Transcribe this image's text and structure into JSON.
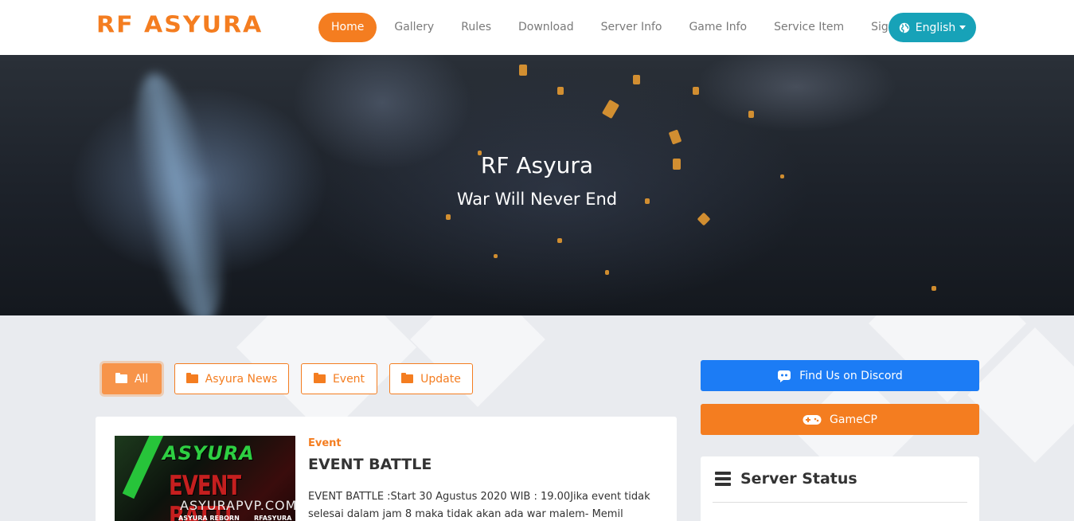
{
  "brand": {
    "logo": "RF ASYURA",
    "accent_color": "#f47d20",
    "info_color": "#17a2b8",
    "discord_color": "#1c7cf5"
  },
  "nav": {
    "items": [
      {
        "label": "Home",
        "active": true
      },
      {
        "label": "Gallery"
      },
      {
        "label": "Rules"
      },
      {
        "label": "Download"
      },
      {
        "label": "Server Info"
      },
      {
        "label": "Game Info"
      },
      {
        "label": "Service Item"
      },
      {
        "label": "Signup"
      }
    ],
    "language": {
      "label": "English",
      "icon": "globe-icon"
    }
  },
  "hero": {
    "title": "RF Asyura",
    "subtitle": "War Will Never End"
  },
  "filters": [
    {
      "label": "All",
      "active": true,
      "icon": "folder-icon"
    },
    {
      "label": "Asyura News",
      "icon": "folder-icon"
    },
    {
      "label": "Event",
      "icon": "folder-icon"
    },
    {
      "label": "Update",
      "icon": "folder-icon"
    }
  ],
  "post": {
    "category": "Event",
    "title": "EVENT BATTLE",
    "excerpt": "EVENT BATTLE :Start 30 Agustus 2020 WIB : 19.00Jika event tidak selesai dalam jam 8 maka tidak akan ada war malem- Memil",
    "thumbnail": {
      "line1": "ASYURA",
      "line2": "EVENT BATTL",
      "line3": "ASYURAPVP.COM",
      "line4": "ASYURA REBORN",
      "line5": "RFASYURA"
    }
  },
  "sidebar": {
    "discord_label": "Find Us on Discord",
    "gamecp_label": "GameCP",
    "status_title": "Server Status"
  }
}
